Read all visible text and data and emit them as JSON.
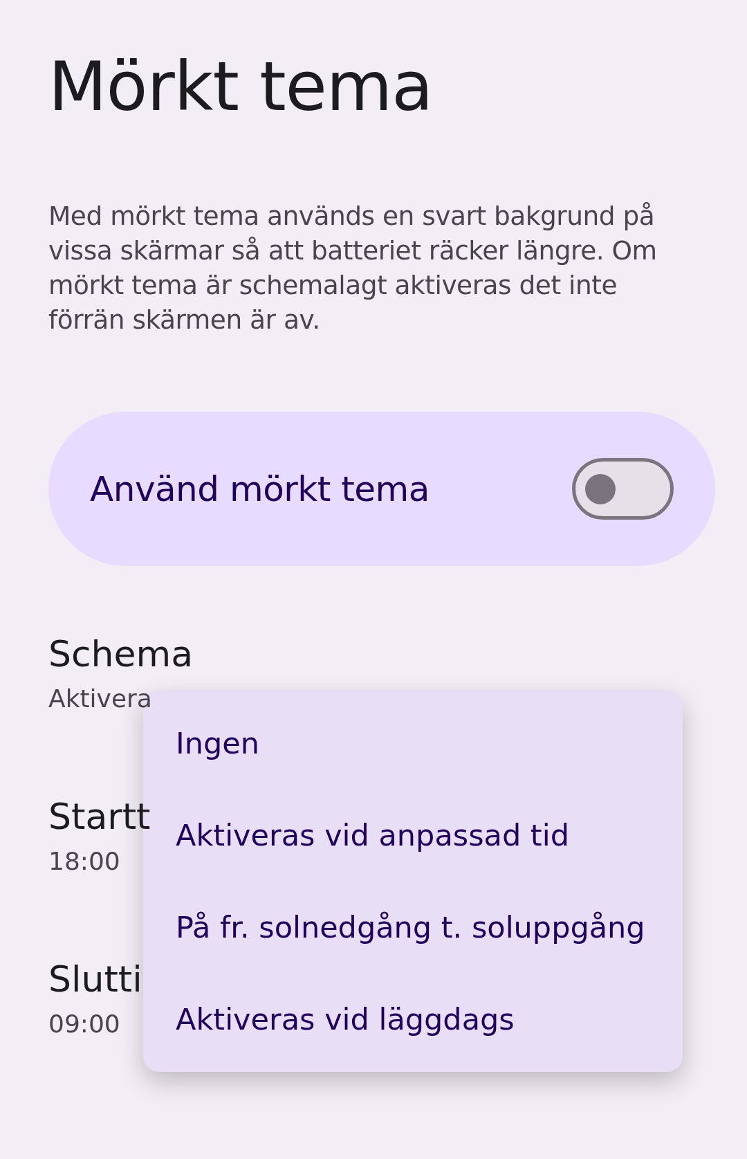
{
  "title": "Mörkt tema",
  "description": "Med mörkt tema används en svart bakgrund på vissa skärmar så att batteriet räcker längre. Om mörkt tema är schemalagt aktiveras det inte förrän skärmen är av.",
  "main_switch": {
    "label": "Använd mörkt tema",
    "on": false
  },
  "settings": [
    {
      "title": "Schema",
      "value": "Aktivera"
    },
    {
      "title": "Startt",
      "value": "18:00"
    },
    {
      "title": "Slutti",
      "value": "09:00"
    }
  ],
  "menu": {
    "items": [
      "Ingen",
      "Aktiveras vid anpassad tid",
      "På fr. solnedgång t. soluppgång",
      "Aktiveras vid läggdags"
    ]
  }
}
